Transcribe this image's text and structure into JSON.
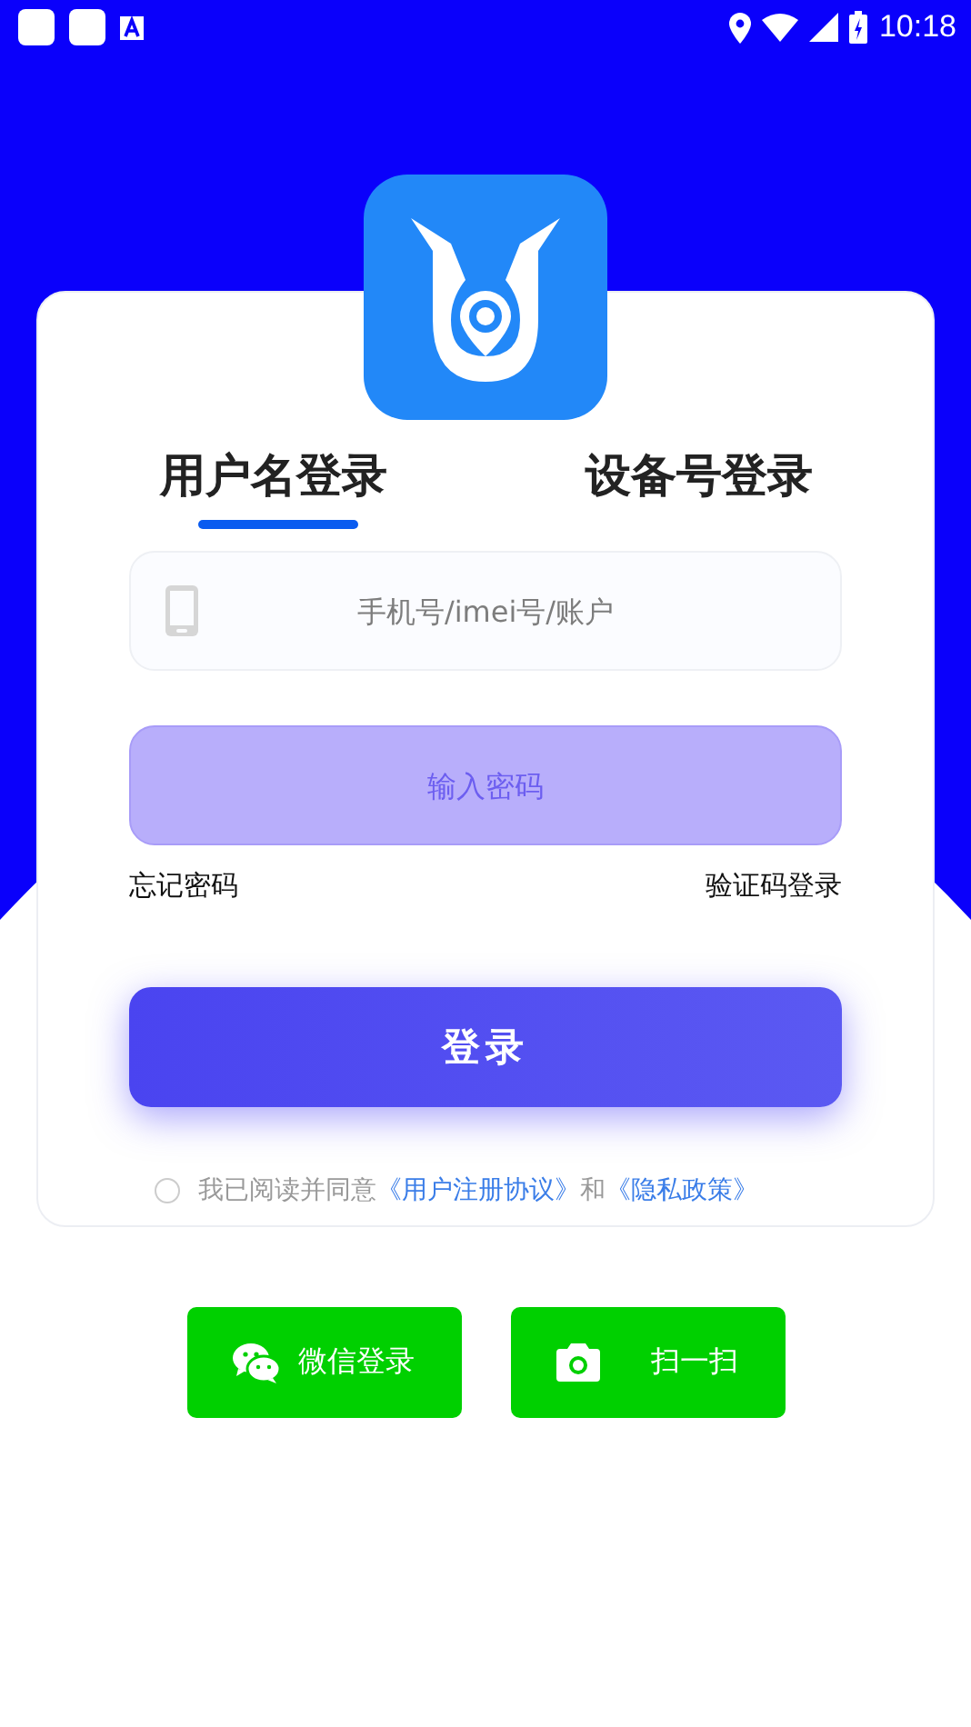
{
  "status_bar": {
    "time": "10:18"
  },
  "tabs": [
    {
      "label": "用户名登录",
      "selected": true
    },
    {
      "label": "设备号登录",
      "selected": false
    }
  ],
  "account_field": {
    "placeholder": "手机号/imei号/账户"
  },
  "password_field": {
    "placeholder": "输入密码"
  },
  "links": {
    "forgot": "忘记密码",
    "sms_login": "验证码登录"
  },
  "login_button": "登录",
  "agreement": {
    "checked": false,
    "text": "我已阅读并同意",
    "terms": "《用户注册协议》",
    "and": "和",
    "privacy": "《隐私政策》"
  },
  "bottom_buttons": [
    {
      "kind": "wechat",
      "label": "微信登录"
    },
    {
      "kind": "scan",
      "label": "扫一扫"
    }
  ]
}
